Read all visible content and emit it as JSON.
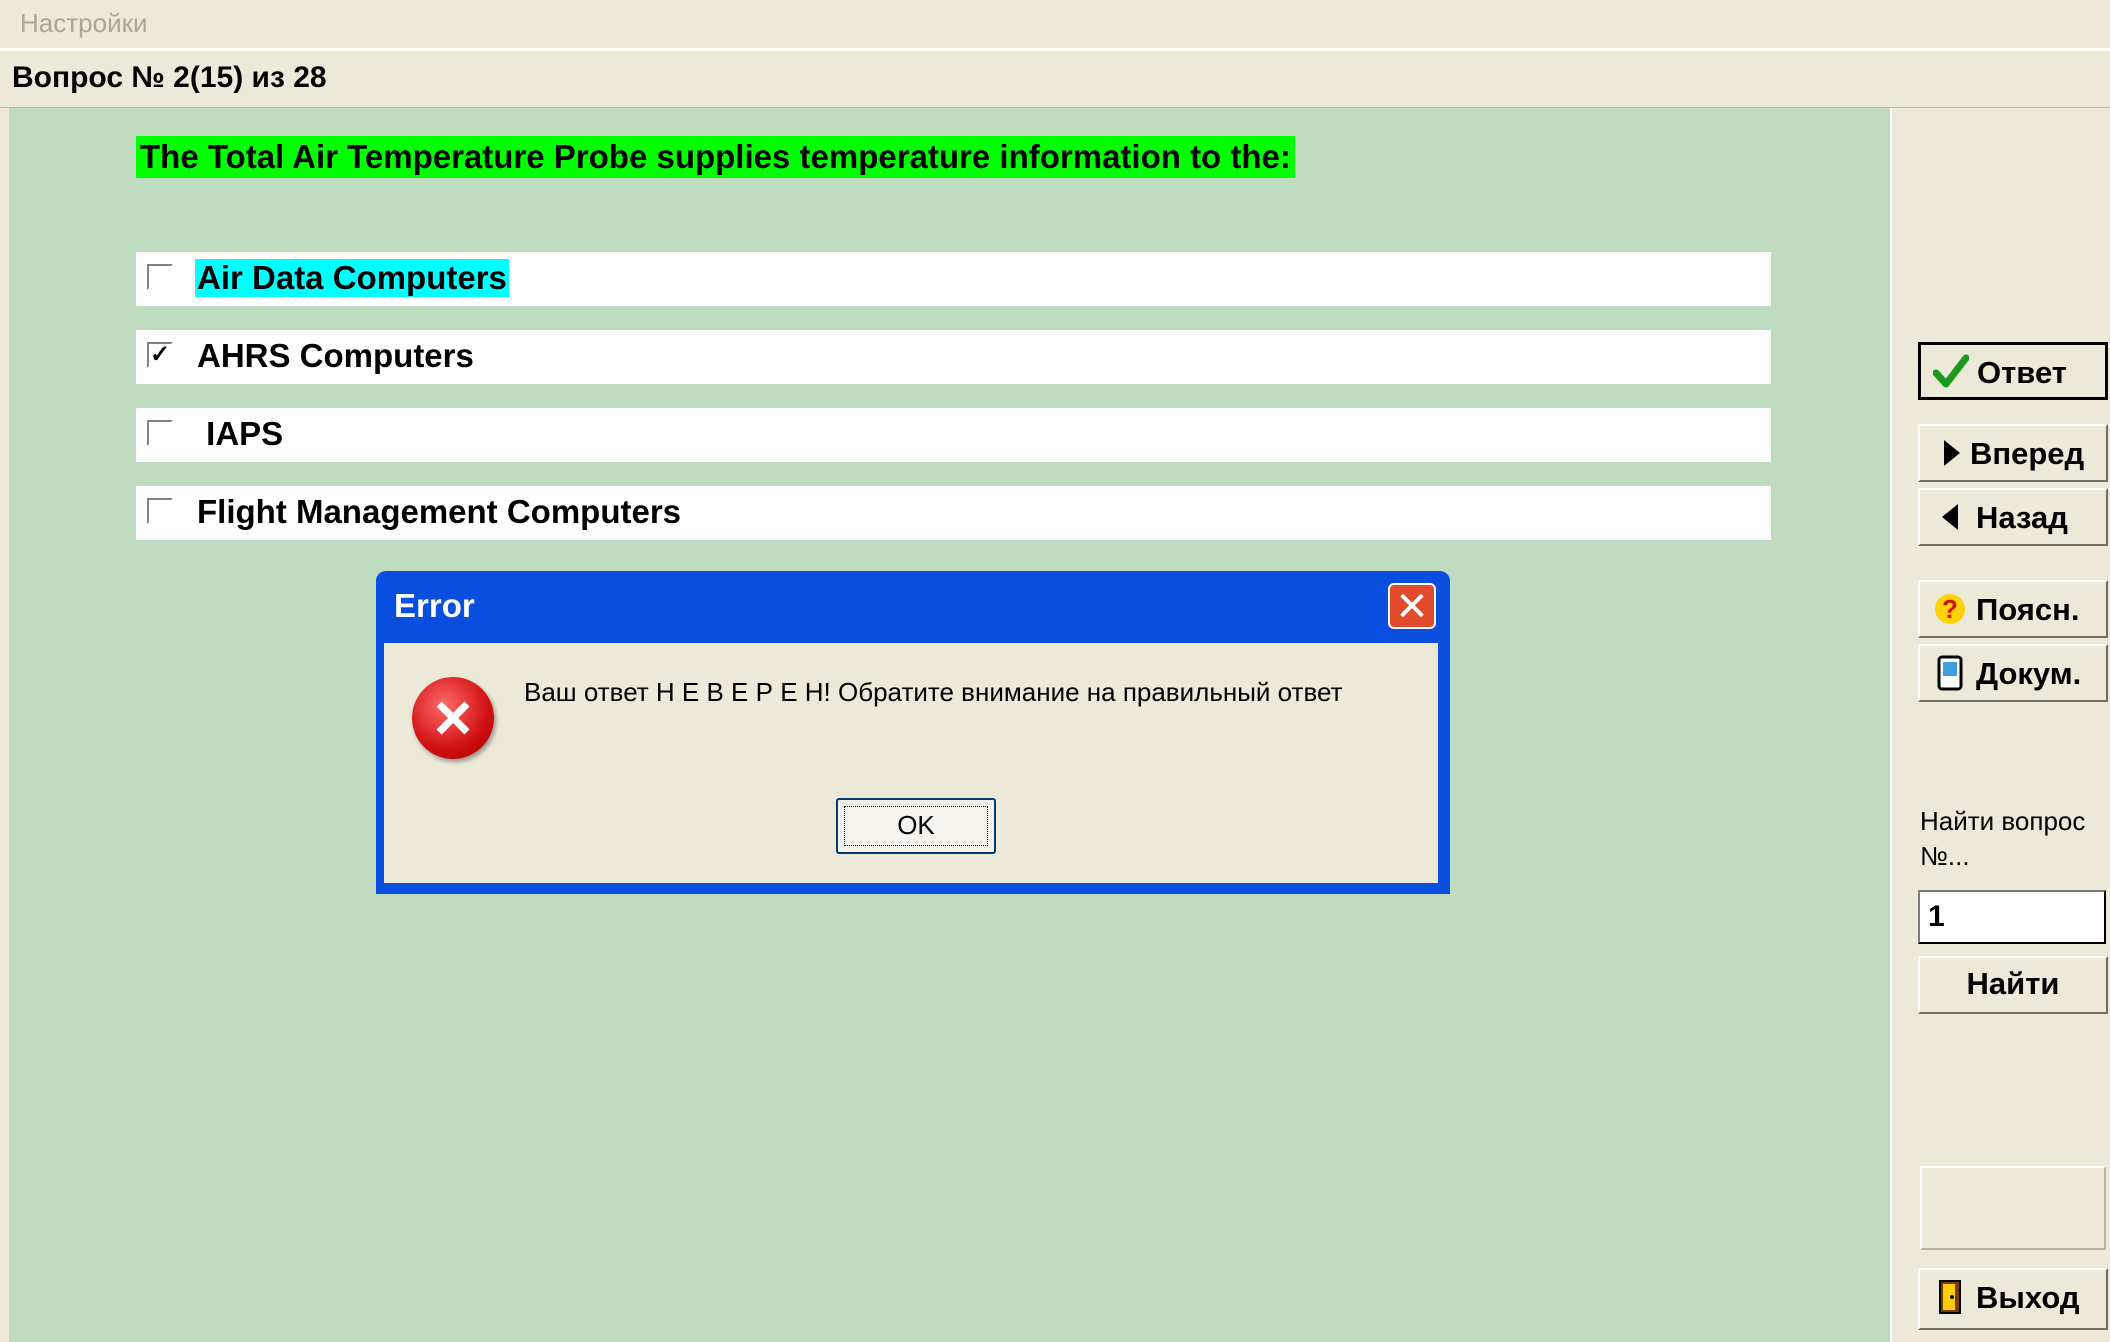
{
  "menu": {
    "settings": "Настройки"
  },
  "header": {
    "question_number": "Вопрос № 2(15) из 28"
  },
  "question": {
    "text": "The Total Air Temperature Probe supplies temperature information to the:"
  },
  "answers": [
    {
      "label": "Air Data Computers",
      "checked": false,
      "highlighted": true
    },
    {
      "label": "AHRS Computers",
      "checked": true,
      "highlighted": false
    },
    {
      "label": " IAPS",
      "checked": false,
      "highlighted": false
    },
    {
      "label": "Flight Management Computers",
      "checked": false,
      "highlighted": false
    }
  ],
  "checkmark": "✓",
  "dialog": {
    "title": "Error",
    "close": "✕",
    "message": "Ваш ответ Н Е В Е Р Е Н! Обратите внимание на правильный ответ",
    "ok": "OK"
  },
  "sidebar": {
    "answer": "Ответ",
    "forward": "Вперед",
    "back": "Назад",
    "explain": "Поясн.",
    "docs": "Докум.",
    "find_label": "Найти вопрос №...",
    "find_value": "1",
    "find_button": "Найти",
    "exit": "Выход"
  },
  "colors": {
    "main_bg": "#c0dcc0",
    "question_highlight": "#00ff00",
    "answer_highlight": "#00ffff",
    "dialog_title": "#0a4ee0"
  }
}
